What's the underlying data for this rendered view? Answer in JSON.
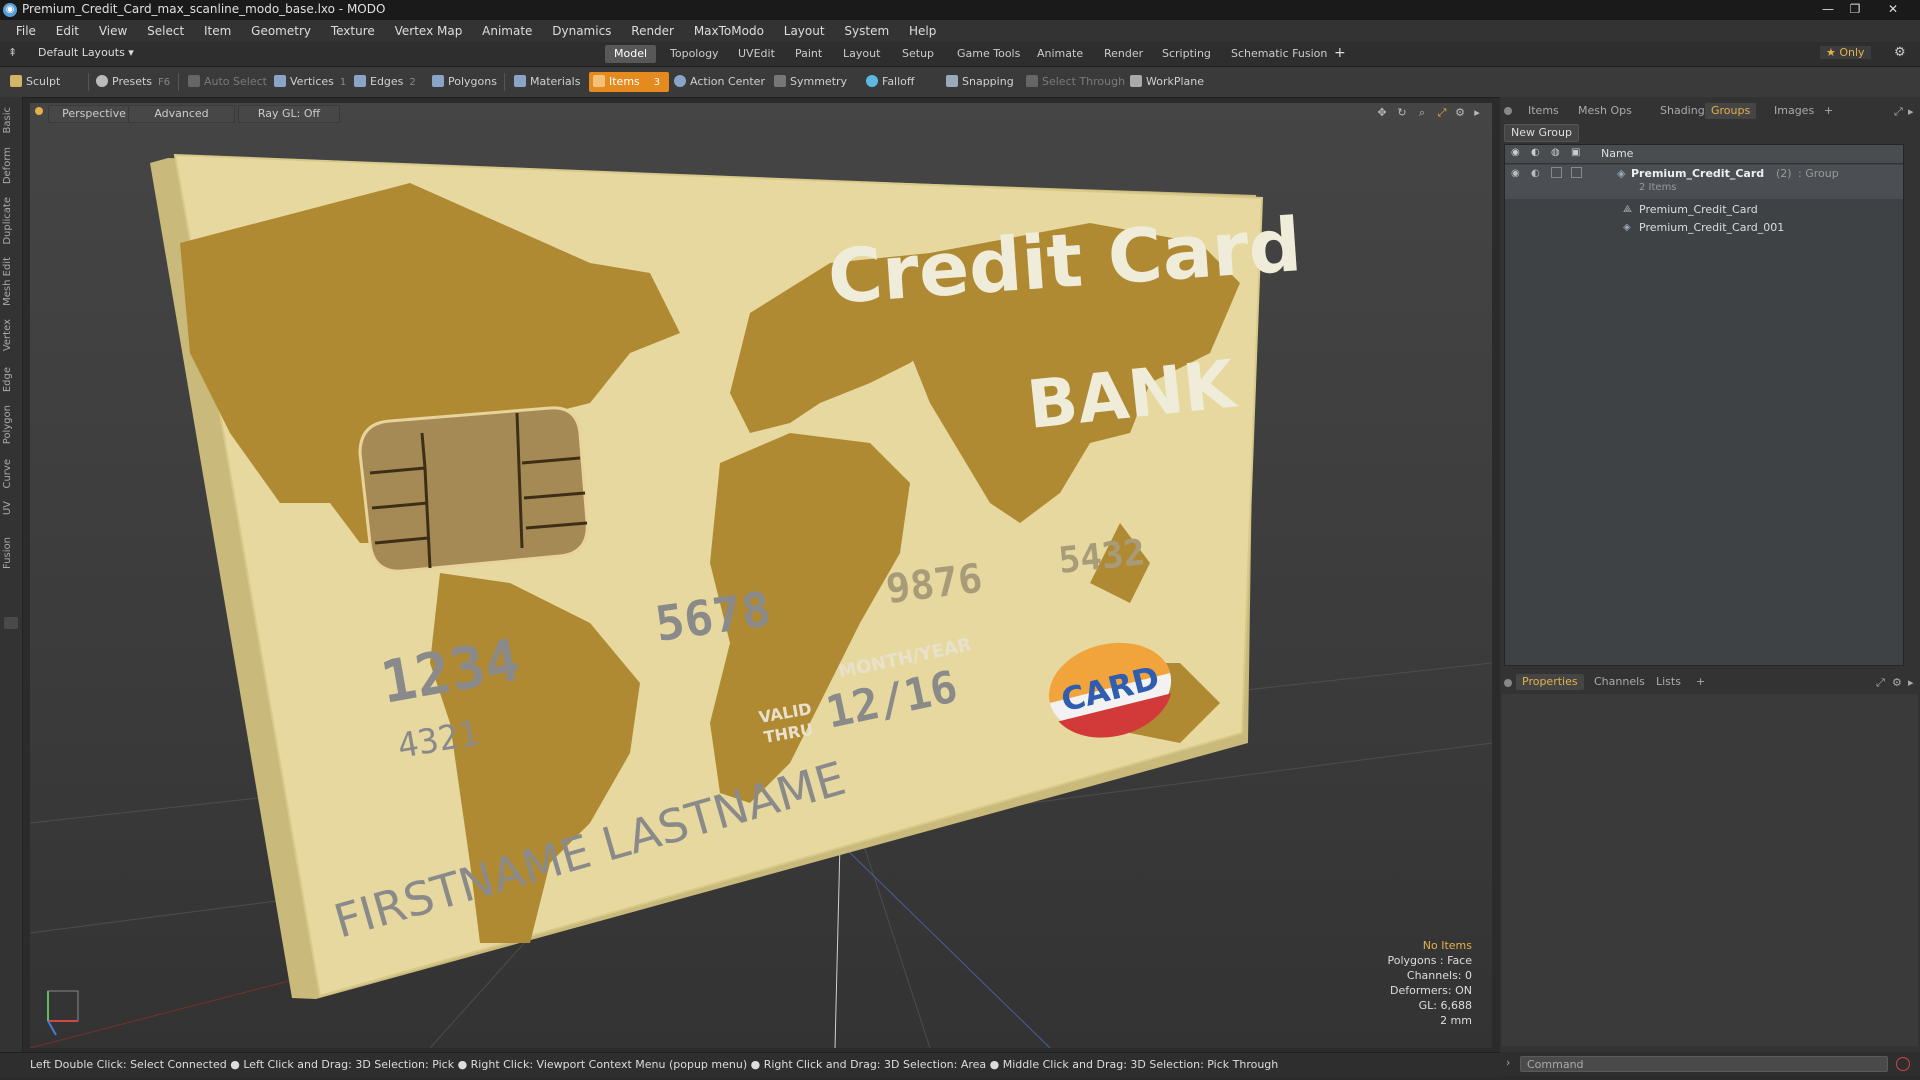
{
  "window": {
    "title": "Premium_Credit_Card_max_scanline_modo_base.lxo - MODO",
    "controls": [
      "—",
      "❐",
      "✕"
    ]
  },
  "menu": [
    "File",
    "Edit",
    "View",
    "Select",
    "Item",
    "Geometry",
    "Texture",
    "Vertex Map",
    "Animate",
    "Dynamics",
    "Render",
    "MaxToModo",
    "Layout",
    "System",
    "Help"
  ],
  "layoutbar": {
    "layouts_label": "Default Layouts ▾",
    "tabs": [
      "Model",
      "Topology",
      "UVEdit",
      "Paint",
      "Layout",
      "Setup",
      "Game Tools",
      "Animate",
      "Render",
      "Scripting",
      "Schematic Fusion"
    ],
    "active_tab": "Model",
    "add": "+",
    "only_label": "★  Only"
  },
  "toolbar": {
    "sculpt": "Sculpt",
    "presets": "Presets",
    "presets_key": "F6",
    "auto_select": "Auto Select",
    "vertices": "Vertices",
    "vertices_count": "1",
    "edges": "Edges",
    "edges_count": "2",
    "polygons": "Polygons",
    "materials": "Materials",
    "items": "Items",
    "items_count": "3",
    "action_center": "Action Center",
    "symmetry": "Symmetry",
    "falloff": "Falloff",
    "snapping": "Snapping",
    "select_through": "Select Through",
    "workplane": "WorkPlane"
  },
  "lefttabs": [
    "Basic",
    "Deform",
    "Duplicate",
    "Mesh Edit",
    "Vertex",
    "Edge",
    "Polygon",
    "Curve",
    "UV",
    "Fusion"
  ],
  "viewport": {
    "perspective": "Perspective",
    "advanced": "Advanced",
    "raygl": "Ray GL: Off",
    "info": {
      "no_items": "No Items",
      "polygons": "Polygons : Face",
      "channels": "Channels: 0",
      "deformers": "Deformers: ON",
      "gl": "GL: 6,688",
      "scale": "2 mm"
    },
    "card": {
      "title": "Credit Card",
      "bank": "BANK",
      "num1": "1234",
      "num2": "5678",
      "num3": "9876",
      "num4": "5432",
      "small_num": "4321",
      "valid": "VALID",
      "thru": "THRU",
      "month_year": "MONTH/YEAR",
      "expiry": "12/16",
      "name": "FIRSTNAME LASTNAME",
      "logo": "CARD"
    }
  },
  "rightpanel": {
    "tabs": [
      "Items",
      "Mesh Ops",
      "Shading",
      "Groups",
      "Images",
      "+"
    ],
    "active_tab": "Groups",
    "new_group": "New Group",
    "column_name": "Name",
    "group": {
      "name": "Premium_Credit_Card",
      "count": "(2)",
      "type": ": Group",
      "subtitle": "2 Items",
      "children": [
        "Premium_Credit_Card",
        "Premium_Credit_Card_001"
      ]
    },
    "lower_tabs": [
      "Properties",
      "Channels",
      "Lists",
      "+"
    ],
    "lower_active": "Properties"
  },
  "statusbar": {
    "text": "Left Double Click: Select Connected ● Left Click and Drag: 3D Selection: Pick ● Right Click: Viewport Context Menu (popup menu) ● Right Click and Drag: 3D Selection: Area ● Middle Click and Drag: 3D Selection: Pick Through"
  },
  "command": {
    "placeholder": "Command"
  },
  "colors": {
    "accent": "#e58a1f",
    "card_base": "#e3d49a",
    "card_map": "#b08a33",
    "info_highlight": "#e3b14a"
  }
}
